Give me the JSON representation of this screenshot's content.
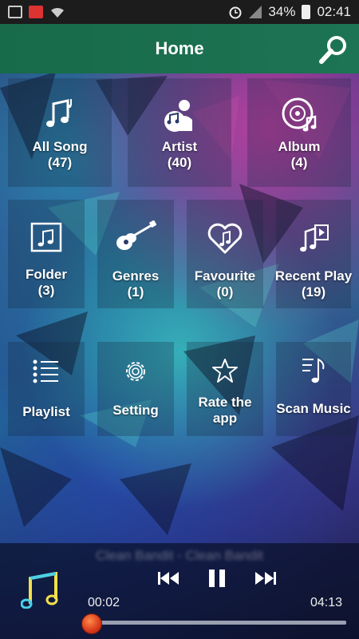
{
  "status_bar": {
    "battery": "34%",
    "time": "02:41"
  },
  "header": {
    "title": "Home"
  },
  "tiles": [
    {
      "label": "All Song",
      "count": "(47)",
      "icon": "music-notes-icon"
    },
    {
      "label": "Artist",
      "count": "(40)",
      "icon": "artist-icon"
    },
    {
      "label": "Album",
      "count": "(4)",
      "icon": "album-icon"
    },
    {
      "label": "Folder",
      "count": "(3)",
      "icon": "folder-icon"
    },
    {
      "label": "Genres",
      "count": "(1)",
      "icon": "guitar-icon"
    },
    {
      "label": "Favourite",
      "count": "(0)",
      "icon": "heart-icon"
    },
    {
      "label": "Recent Play",
      "count": "(19)",
      "icon": "recent-play-icon"
    },
    {
      "label": "Playlist",
      "icon": "list-icon"
    },
    {
      "label": "Setting",
      "icon": "gear-icon"
    },
    {
      "label": "Rate the app",
      "icon": "star-icon"
    },
    {
      "label": "Scan Music",
      "icon": "scan-music-icon"
    }
  ],
  "player": {
    "track_title": "Clean Bandit - Clean Bandit",
    "elapsed": "00:02",
    "duration": "04:13",
    "progress": 0.008
  },
  "colors": {
    "header": "#1d7454",
    "seek_thumb": "#d8381a"
  }
}
